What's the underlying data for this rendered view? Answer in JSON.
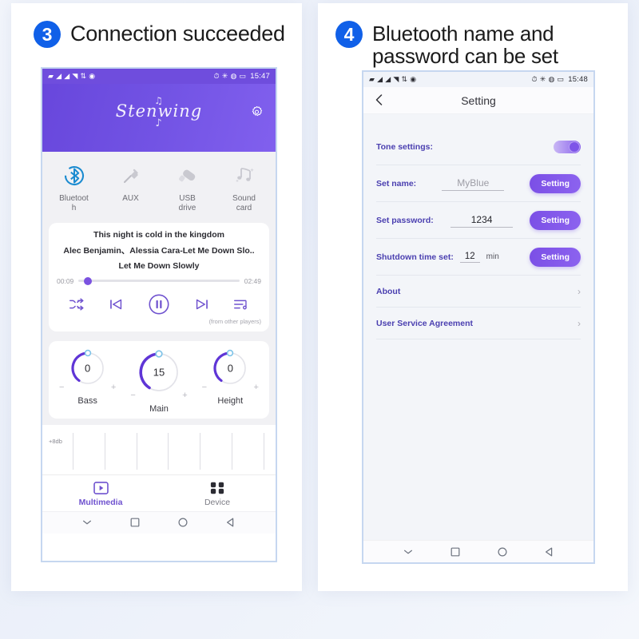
{
  "panels": {
    "three": {
      "badge": "3",
      "title": "Connection succeeded",
      "statusbar": {
        "left_icons": [
          "sim-icon",
          "signal-bar-icon",
          "signal-bar-icon",
          "wifi-icon",
          "data-rate-icon",
          "location-dot-icon"
        ],
        "right_icons": [
          "alarm-icon",
          "bluetooth-icon",
          "location-icon",
          "battery-icon"
        ],
        "time": "15:47"
      },
      "app_header": {
        "brand": "Stenwing",
        "note_top": "♫",
        "note_bottom": "♪",
        "gear": "gear-icon"
      },
      "sources": [
        {
          "icon": "bluetooth-icon",
          "label": "Bluetooth",
          "label_line1": "Bluetoot",
          "label_line2": "h",
          "active": true
        },
        {
          "icon": "aux-plug-icon",
          "label": "AUX",
          "label_line1": "AUX",
          "label_line2": "",
          "active": false
        },
        {
          "icon": "usb-drive-icon",
          "label": "USB drive",
          "label_line1": "USB",
          "label_line2": "drive",
          "active": false
        },
        {
          "icon": "music-note-icon",
          "label": "Sound card",
          "label_line1": "Sound",
          "label_line2": "card",
          "active": false
        }
      ],
      "now_playing": {
        "line1": "This night is cold in the kingdom",
        "line2": "Alec Benjamin、Alessia Cara-Let Me Down Slo..",
        "line3": "Let Me Down Slowly",
        "elapsed": "00:09",
        "duration": "02:49",
        "progress_percent": 6,
        "controls": [
          "shuffle-icon",
          "previous-track-icon",
          "pause-icon",
          "next-track-icon",
          "playlist-icon"
        ],
        "source_note": "(from other players)"
      },
      "knobs": [
        {
          "label": "Bass",
          "value": "0",
          "minus": "−",
          "plus": "+",
          "fill_percent": 34
        },
        {
          "label": "Main",
          "value": "15",
          "minus": "−",
          "plus": "+",
          "fill_percent": 45
        },
        {
          "label": "Height",
          "value": "0",
          "minus": "−",
          "plus": "+",
          "fill_percent": 34
        }
      ],
      "equalizer": {
        "db_label": "+8db",
        "bar_count": 7
      },
      "tabs": [
        {
          "icon": "multimedia-play-icon",
          "label": "Multimedia",
          "active": true
        },
        {
          "icon": "device-grid-icon",
          "label": "Device",
          "active": false
        }
      ],
      "navbar": [
        "chevron-down-icon",
        "square-icon",
        "circle-icon",
        "back-triangle-icon"
      ]
    },
    "four": {
      "badge": "4",
      "title_line1": "Bluetooth name and",
      "title_line2": "password can be set",
      "statusbar": {
        "left_icons": [
          "sim-icon",
          "signal-bar-icon",
          "signal-bar-icon",
          "wifi-icon",
          "data-rate-icon",
          "location-dot-icon"
        ],
        "right_icons": [
          "alarm-icon",
          "bluetooth-icon",
          "location-icon",
          "battery-icon"
        ],
        "time": "15:48"
      },
      "header": {
        "back": "back-chevron-icon",
        "title": "Setting"
      },
      "rows": {
        "tone": {
          "key": "Tone settings:",
          "toggle_on": true
        },
        "name": {
          "key": "Set name:",
          "placeholder": "MyBlue",
          "button": "Setting"
        },
        "password": {
          "key": "Set password:",
          "value": "1234",
          "button": "Setting"
        },
        "shutdown": {
          "key": "Shutdown time set:",
          "value": "12",
          "unit": "min",
          "button": "Setting"
        },
        "about": {
          "key": "About",
          "chevron": "›"
        },
        "agreement": {
          "key": "User Service Agreement",
          "chevron": "›"
        }
      },
      "navbar": [
        "chevron-down-icon",
        "square-icon",
        "circle-icon",
        "back-triangle-icon"
      ]
    }
  },
  "colors": {
    "badge_blue": "#1060e8",
    "purple": "#6f4ddd",
    "purple_light": "#8160ee",
    "accent_text": "#4a3fb0",
    "bluetooth_blue": "#1b8bd0"
  }
}
